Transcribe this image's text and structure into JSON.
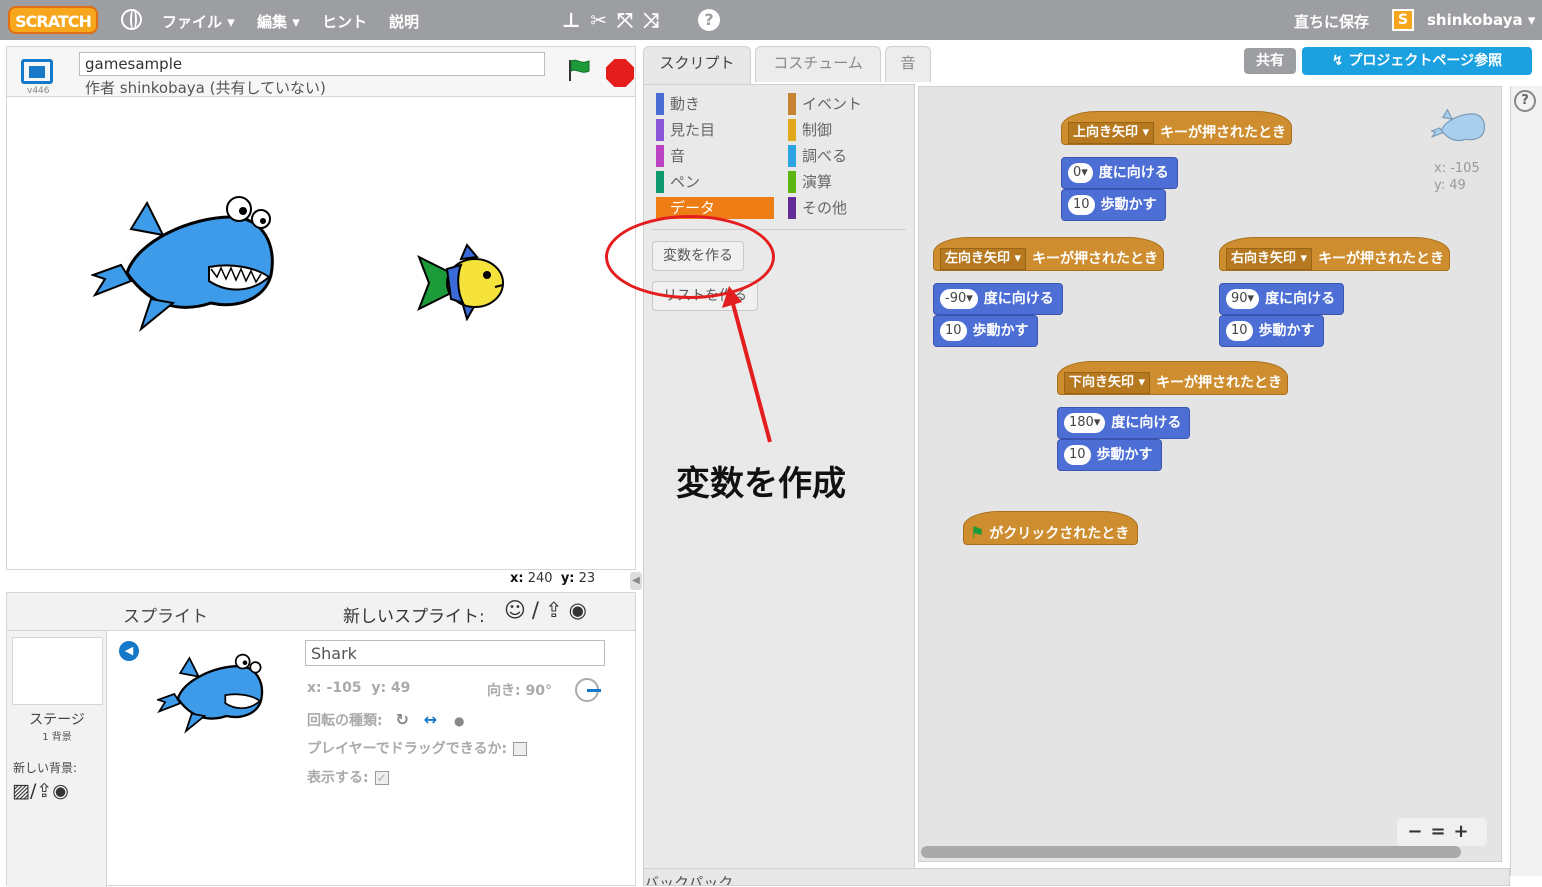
{
  "menubar": {
    "logo": "SCRATCH",
    "file": "ファイル ▾",
    "edit": "編集 ▾",
    "hint": "ヒント",
    "about": "説明",
    "save_now": "直ちに保存",
    "user_badge": "S",
    "user": "shinkobaya ▾"
  },
  "stage": {
    "version": "v446",
    "project_title": "gamesample",
    "author": "作者 shinkobaya (共有していない)",
    "mouse_x_label": "x:",
    "mouse_x": "240",
    "mouse_y_label": "y:",
    "mouse_y": "23"
  },
  "sprites": {
    "header": "スプライト",
    "new_sprite": "新しいスプライト:",
    "stage_label": "ステージ",
    "stage_sub": "1 背景",
    "new_backdrop": "新しい背景:",
    "sprite_name": "Shark",
    "x_label": "x:",
    "x": "-105",
    "y_label": "y:",
    "y": "49",
    "direction_label": "向き:",
    "direction": "90°",
    "rotation_label": "回転の種類:",
    "drag_label": "プレイヤーでドラッグできるか:",
    "show_label": "表示する:"
  },
  "tabs": [
    "スクリプト",
    "コスチューム",
    "音"
  ],
  "top_buttons": {
    "share": "共有",
    "project_page": "プロジェクトページ参照"
  },
  "categories": [
    {
      "label": "動き",
      "color": "#4a6cd4"
    },
    {
      "label": "見た目",
      "color": "#8a55d7"
    },
    {
      "label": "音",
      "color": "#bb42c3"
    },
    {
      "label": "ペン",
      "color": "#0e9a6c"
    },
    {
      "label": "データ",
      "color": "#ee7d16"
    },
    {
      "label": "イベント",
      "color": "#c88330"
    },
    {
      "label": "制御",
      "color": "#e1a91a"
    },
    {
      "label": "調べる",
      "color": "#2ca5e2"
    },
    {
      "label": "演算",
      "color": "#5cb712"
    },
    {
      "label": "その他",
      "color": "#632d99"
    }
  ],
  "palette_buttons": {
    "make_variable": "変数を作る",
    "make_list": "リストを作る"
  },
  "scripts": {
    "mini_x": "x: -105",
    "mini_y": "y: 49",
    "up": {
      "key": "上向き矢印 ▾",
      "hat": "キーが押されたとき",
      "dir": "0▾",
      "dir_text": "度に向ける",
      "steps": "10",
      "steps_text": "歩動かす"
    },
    "left": {
      "key": "左向き矢印 ▾",
      "hat": "キーが押されたとき",
      "dir": "-90▾",
      "dir_text": "度に向ける",
      "steps": "10",
      "steps_text": "歩動かす"
    },
    "right": {
      "key": "右向き矢印 ▾",
      "hat": "キーが押されたとき",
      "dir": "90▾",
      "dir_text": "度に向ける",
      "steps": "10",
      "steps_text": "歩動かす"
    },
    "down": {
      "key": "下向き矢印 ▾",
      "hat": "キーが押されたとき",
      "dir": "180▾",
      "dir_text": "度に向ける",
      "steps": "10",
      "steps_text": "歩動かす"
    },
    "flag_hat": "がクリックされたとき"
  },
  "backpack": "バックパック",
  "annotation": "変数を作成"
}
